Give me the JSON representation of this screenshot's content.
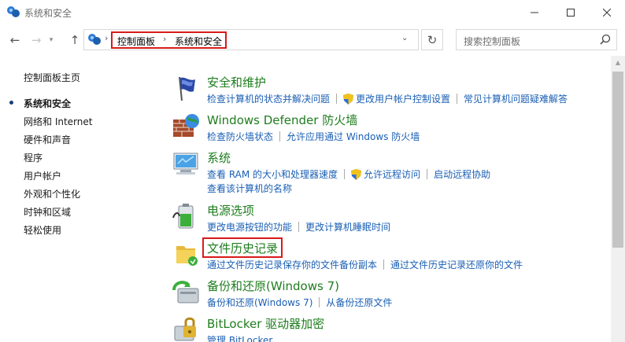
{
  "window": {
    "title": "系统和安全"
  },
  "address": {
    "crumb1": "控制面板",
    "crumb2": "系统和安全",
    "search_placeholder": "搜索控制面板"
  },
  "sidebar": {
    "home": "控制面板主页",
    "items": [
      {
        "label": "系统和安全",
        "current": true
      },
      {
        "label": "网络和 Internet"
      },
      {
        "label": "硬件和声音"
      },
      {
        "label": "程序"
      },
      {
        "label": "用户帐户"
      },
      {
        "label": "外观和个性化"
      },
      {
        "label": "时钟和区域"
      },
      {
        "label": "轻松使用"
      }
    ]
  },
  "categories": [
    {
      "title": "安全和维护",
      "icon": "flag-icon",
      "links": [
        "检查计算机的状态并解决问题",
        "更改用户帐户控制设置",
        "常见计算机问题疑难解答"
      ]
    },
    {
      "title": "Windows Defender 防火墙",
      "icon": "firewall-icon",
      "links": [
        "检查防火墙状态",
        "允许应用通过 Windows 防火墙"
      ]
    },
    {
      "title": "系统",
      "icon": "computer-icon",
      "links": [
        "查看 RAM 的大小和处理器速度",
        "允许远程访问",
        "启动远程协助"
      ],
      "links2": [
        "查看该计算机的名称"
      ]
    },
    {
      "title": "电源选项",
      "icon": "battery-icon",
      "links": [
        "更改电源按钮的功能",
        "更改计算机睡眠时间"
      ]
    },
    {
      "title": "文件历史记录",
      "icon": "file-history-icon",
      "links": [
        "通过文件历史记录保存你的文件备份副本",
        "通过文件历史记录还原你的文件"
      ]
    },
    {
      "title": "备份和还原(Windows 7)",
      "icon": "backup-icon",
      "links": [
        "备份和还原(Windows 7)",
        "从备份还原文件"
      ]
    },
    {
      "title": "BitLocker 驱动器加密",
      "icon": "bitlocker-icon",
      "links": [
        "管理 BitLocker"
      ]
    }
  ],
  "colors": {
    "title_green": "#1e7d1e",
    "link_blue": "#1a5fb4",
    "highlight_red": "#d81a1a"
  }
}
